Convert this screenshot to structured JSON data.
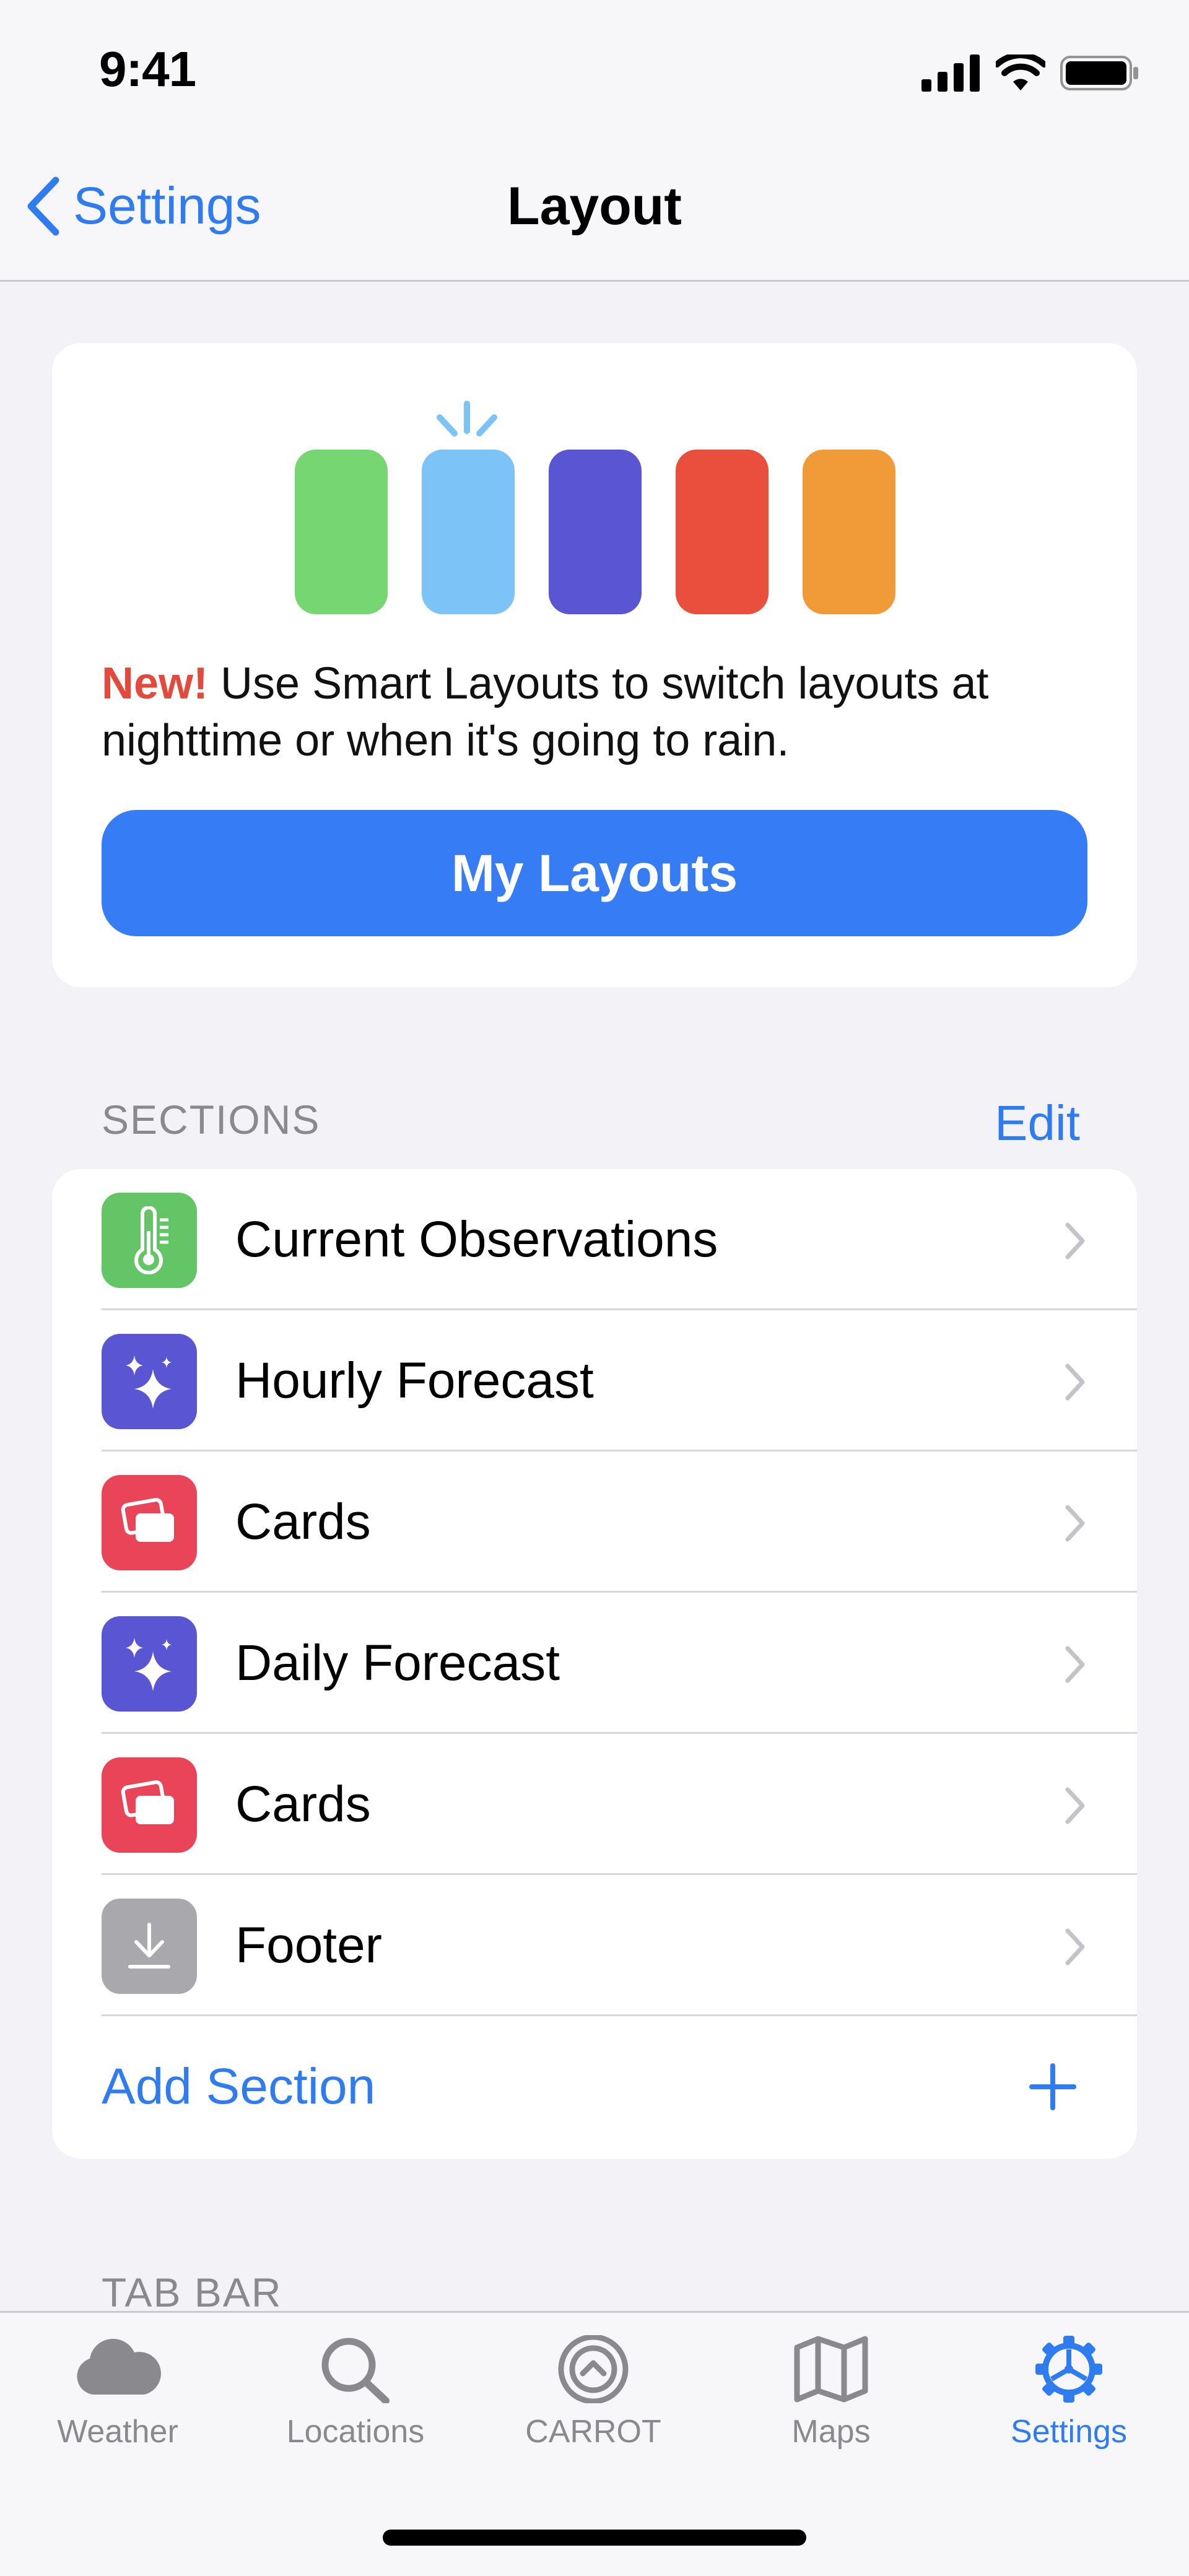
{
  "status_bar": {
    "time": "9:41"
  },
  "nav": {
    "back_label": "Settings",
    "title": "Layout"
  },
  "promo": {
    "new_label": "New!",
    "text": " Use Smart Layouts to switch layouts at nighttime or when it's going to rain.",
    "button_label": "My Layouts",
    "swatch_colors": [
      "#76d672",
      "#7cc4f8",
      "#5a55d2",
      "#ea4e3d",
      "#f19a38"
    ]
  },
  "sections": {
    "header": "SECTIONS",
    "edit_label": "Edit",
    "items": [
      {
        "label": "Current Observations",
        "icon": "thermometer-icon",
        "color": "#63c565"
      },
      {
        "label": "Hourly Forecast",
        "icon": "sparkles-icon",
        "color": "#5a55d2"
      },
      {
        "label": "Cards",
        "icon": "cards-icon",
        "color": "#ea4458"
      },
      {
        "label": "Daily Forecast",
        "icon": "sparkles-icon",
        "color": "#5a55d2"
      },
      {
        "label": "Cards",
        "icon": "cards-icon",
        "color": "#ea4458"
      },
      {
        "label": "Footer",
        "icon": "download-icon",
        "color": "#a9a9ad"
      }
    ],
    "add_label": "Add Section"
  },
  "tab_bar_header": "TAB BAR",
  "tabs": [
    {
      "label": "Weather",
      "icon": "cloud-icon",
      "active": false
    },
    {
      "label": "Locations",
      "icon": "search-icon",
      "active": false
    },
    {
      "label": "CARROT",
      "icon": "carrot-icon",
      "active": false
    },
    {
      "label": "Maps",
      "icon": "map-icon",
      "active": false
    },
    {
      "label": "Settings",
      "icon": "gear-icon",
      "active": true
    }
  ],
  "colors": {
    "accent": "#2f7bf0",
    "new_badge": "#e24a3b",
    "button": "#357cf5"
  }
}
